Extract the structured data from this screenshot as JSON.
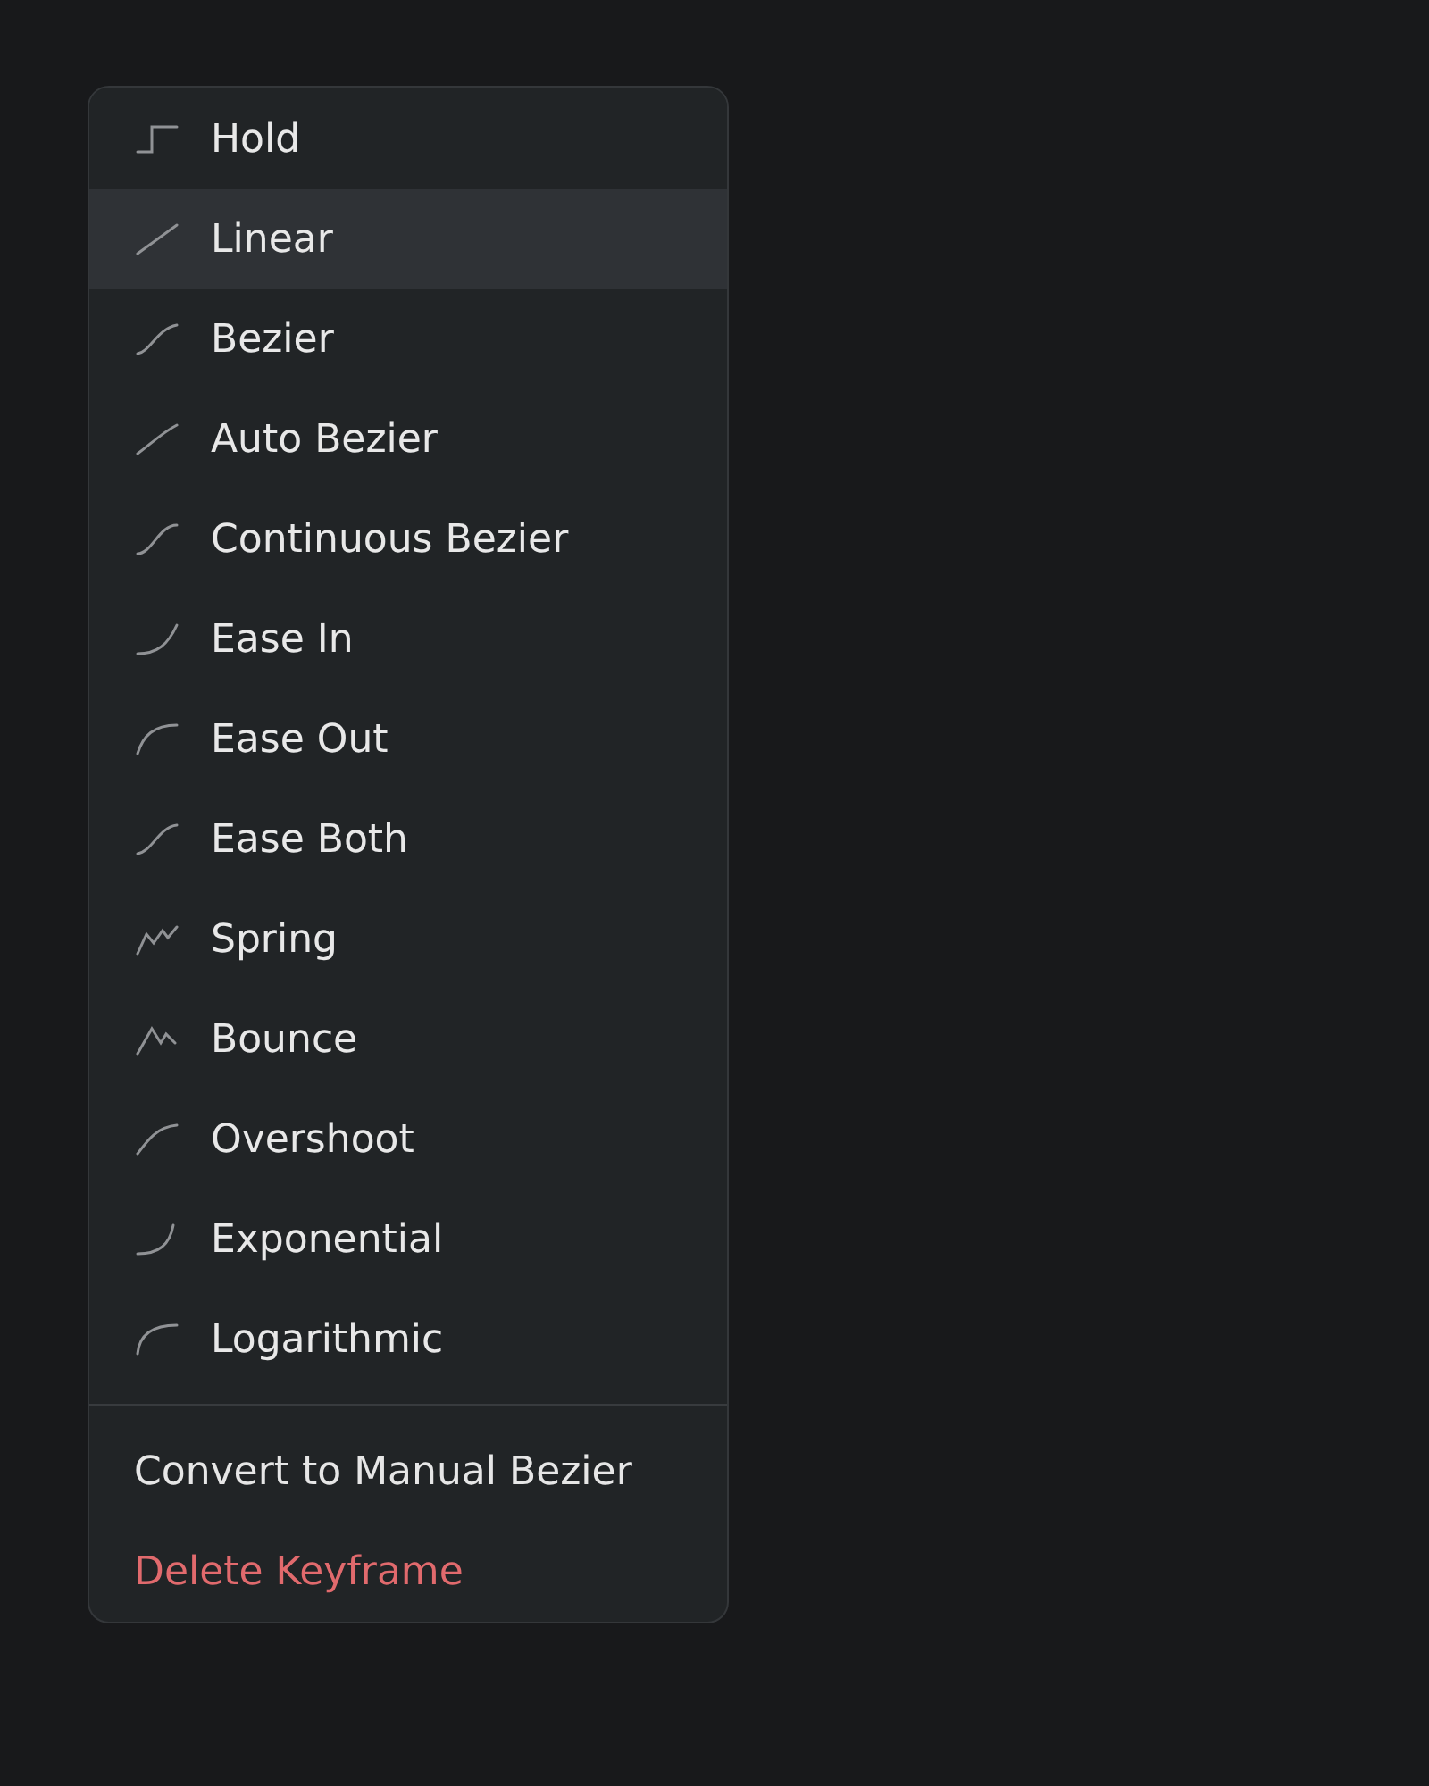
{
  "menu": {
    "interpolations": [
      {
        "label": "Hold",
        "selected": false
      },
      {
        "label": "Linear",
        "selected": true
      },
      {
        "label": "Bezier",
        "selected": false
      },
      {
        "label": "Auto Bezier",
        "selected": false
      },
      {
        "label": "Continuous Bezier",
        "selected": false
      },
      {
        "label": "Ease In",
        "selected": false
      },
      {
        "label": "Ease Out",
        "selected": false
      },
      {
        "label": "Ease Both",
        "selected": false
      },
      {
        "label": "Spring",
        "selected": false
      },
      {
        "label": "Bounce",
        "selected": false
      },
      {
        "label": "Overshoot",
        "selected": false
      },
      {
        "label": "Exponential",
        "selected": false
      },
      {
        "label": "Logarithmic",
        "selected": false
      }
    ],
    "actions": [
      {
        "label": "Convert to Manual Bezier",
        "kind": "normal"
      },
      {
        "label": "Delete Keyframe",
        "kind": "destructive"
      }
    ]
  }
}
